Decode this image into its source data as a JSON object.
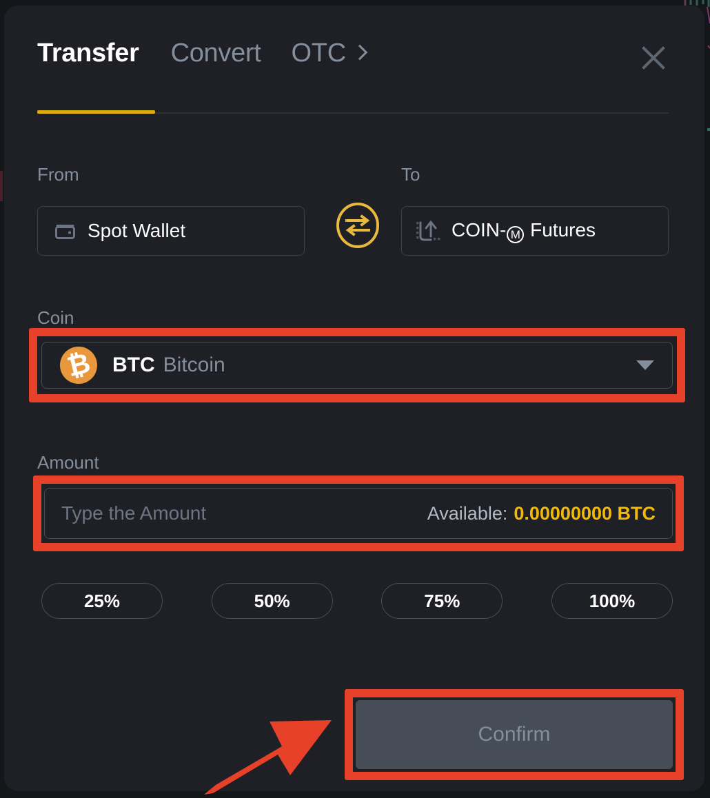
{
  "background": {
    "page_bg_color": "#14161a"
  },
  "modal": {
    "bg_color": "#1e2026",
    "close_icon": "close-icon",
    "tabs": [
      {
        "label": "Transfer",
        "active": true
      },
      {
        "label": "Convert",
        "active": false
      },
      {
        "label": "OTC",
        "active": false,
        "chevron": "chevron-right-icon"
      }
    ],
    "active_tab_accent": "#f0b90b"
  },
  "transfer_form": {
    "from": {
      "label": "From",
      "value": "Spot Wallet",
      "icon": "wallet-icon"
    },
    "to": {
      "label": "To",
      "value_prefix": "COIN-",
      "value_badge": "M",
      "value_suffix": " Futures",
      "icon": "futures-trend-icon"
    },
    "swap": {
      "icon": "swap-arrows-icon",
      "color": "#e7b93c"
    },
    "coin": {
      "label": "Coin",
      "symbol": "BTC",
      "name": "Bitcoin",
      "logo_glyph": "₿",
      "logo_color": "#e8973c",
      "caret": "chevron-down-icon"
    },
    "amount": {
      "label": "Amount",
      "value": "",
      "placeholder": "Type the Amount",
      "available_label": "Available:",
      "available_value": "0.00000000 BTC",
      "available_color": "#f0b90b"
    },
    "percent_buttons": [
      "25%",
      "50%",
      "75%",
      "100%"
    ],
    "confirm": {
      "label": "Confirm",
      "disabled": true,
      "bg_color": "#474d57",
      "text_color": "#848e9c"
    }
  },
  "annotations": {
    "color": "#e8412a",
    "highlight_boxes": [
      "coin-selector",
      "amount-input",
      "confirm-button"
    ],
    "arrow": "points-up-right-to-confirm-button"
  }
}
